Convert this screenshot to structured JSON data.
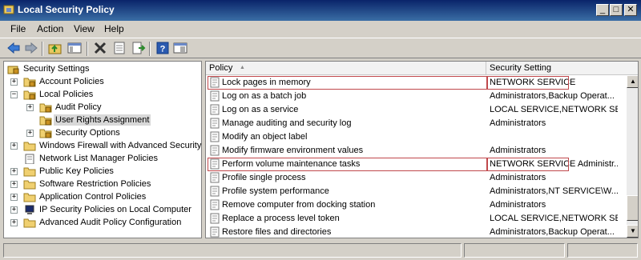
{
  "window": {
    "title": "Local Security Policy",
    "minimize": "_",
    "maximize": "□",
    "close": "✕"
  },
  "menu": [
    "File",
    "Action",
    "View",
    "Help"
  ],
  "toolbar": [
    "back-icon",
    "forward-icon",
    "up-folder-icon",
    "show-hide-tree-icon",
    "delete-icon",
    "properties-icon",
    "export-list-icon",
    "help-icon",
    "console-tree-icon"
  ],
  "tree": [
    {
      "label": "Security Settings",
      "level": 0,
      "expander": ""
    },
    {
      "label": "Account Policies",
      "level": 1,
      "expander": "+"
    },
    {
      "label": "Local Policies",
      "level": 1,
      "expander": "−"
    },
    {
      "label": "Audit Policy",
      "level": 2,
      "expander": "+"
    },
    {
      "label": "User Rights Assignment",
      "level": 2,
      "expander": "",
      "selected": true
    },
    {
      "label": "Security Options",
      "level": 2,
      "expander": "+"
    },
    {
      "label": "Windows Firewall with Advanced Security",
      "level": 1,
      "expander": "+"
    },
    {
      "label": "Network List Manager Policies",
      "level": 1,
      "expander": ""
    },
    {
      "label": "Public Key Policies",
      "level": 1,
      "expander": "+"
    },
    {
      "label": "Software Restriction Policies",
      "level": 1,
      "expander": "+"
    },
    {
      "label": "Application Control Policies",
      "level": 1,
      "expander": "+"
    },
    {
      "label": "IP Security Policies on Local Computer",
      "level": 1,
      "expander": "+"
    },
    {
      "label": "Advanced Audit Policy Configuration",
      "level": 1,
      "expander": "+"
    }
  ],
  "columns": {
    "policy": "Policy",
    "sort_indicator": "▲",
    "setting": "Security Setting"
  },
  "policies": [
    {
      "name": "Lock pages in memory",
      "setting": "NETWORK SERVICE",
      "highlight": true
    },
    {
      "name": "Log on as a batch job",
      "setting": "Administrators,Backup Operat..."
    },
    {
      "name": "Log on as a service",
      "setting": "LOCAL SERVICE,NETWORK SE..."
    },
    {
      "name": "Manage auditing and security log",
      "setting": "Administrators"
    },
    {
      "name": "Modify an object label",
      "setting": ""
    },
    {
      "name": "Modify firmware environment values",
      "setting": "Administrators"
    },
    {
      "name": "Perform volume maintenance tasks",
      "setting": "NETWORK SERVICE Administr...",
      "highlight": true
    },
    {
      "name": "Profile single process",
      "setting": "Administrators"
    },
    {
      "name": "Profile system performance",
      "setting": "Administrators,NT SERVICE\\W..."
    },
    {
      "name": "Remove computer from docking station",
      "setting": "Administrators"
    },
    {
      "name": "Replace a process level token",
      "setting": "LOCAL SERVICE,NETWORK SE..."
    },
    {
      "name": "Restore files and directories",
      "setting": "Administrators,Backup Operat..."
    }
  ],
  "scrollbar": {
    "up": "▲",
    "down": "▼"
  },
  "colors": {
    "title_start": "#0a246a",
    "title_end": "#3a6ea5",
    "highlight_border": "#c0484c",
    "selected_bg": "#d8d8d8"
  }
}
